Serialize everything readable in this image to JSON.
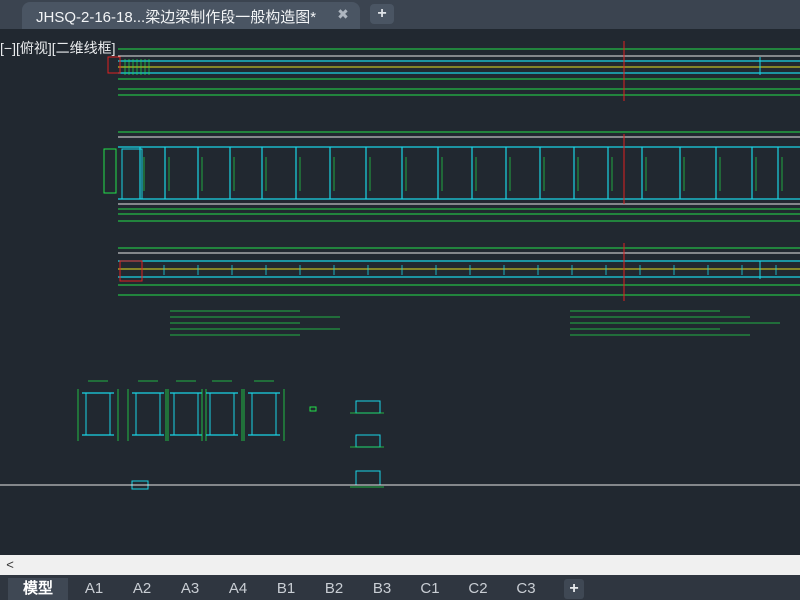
{
  "document_tab": {
    "title": "JHSQ-2-16-18...梁边梁制作段一般构造图*",
    "close_glyph": "✖",
    "new_tab_glyph": "+"
  },
  "viewport": {
    "label": "[−][俯视][二维线框]"
  },
  "scrollbar": {
    "left_arrow": "<"
  },
  "layout_tabs": {
    "items": [
      {
        "label": "模型",
        "active": true
      },
      {
        "label": "A1",
        "active": false
      },
      {
        "label": "A2",
        "active": false
      },
      {
        "label": "A3",
        "active": false
      },
      {
        "label": "A4",
        "active": false
      },
      {
        "label": "B1",
        "active": false
      },
      {
        "label": "B2",
        "active": false
      },
      {
        "label": "B3",
        "active": false
      },
      {
        "label": "C1",
        "active": false
      },
      {
        "label": "C2",
        "active": false
      },
      {
        "label": "C3",
        "active": false
      }
    ],
    "add_glyph": "+"
  },
  "colors": {
    "background": "#212830",
    "cad_green": "#22e04a",
    "cad_cyan": "#19d4e6",
    "cad_yellow": "#e8e020",
    "cad_red": "#e02020",
    "cad_white": "#e6e6e6"
  }
}
